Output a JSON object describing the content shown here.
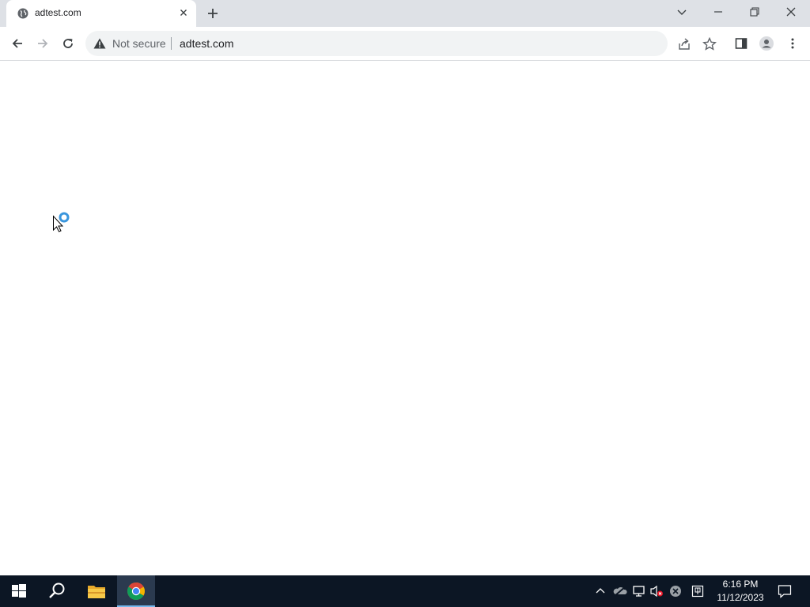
{
  "browser": {
    "tab": {
      "title": "adtest.com",
      "favicon": "globe-icon"
    },
    "toolbar": {
      "security_label": "Not secure",
      "url": "adtest.com"
    }
  },
  "taskbar": {
    "clock": {
      "time": "6:16 PM",
      "date": "11/12/2023"
    }
  }
}
